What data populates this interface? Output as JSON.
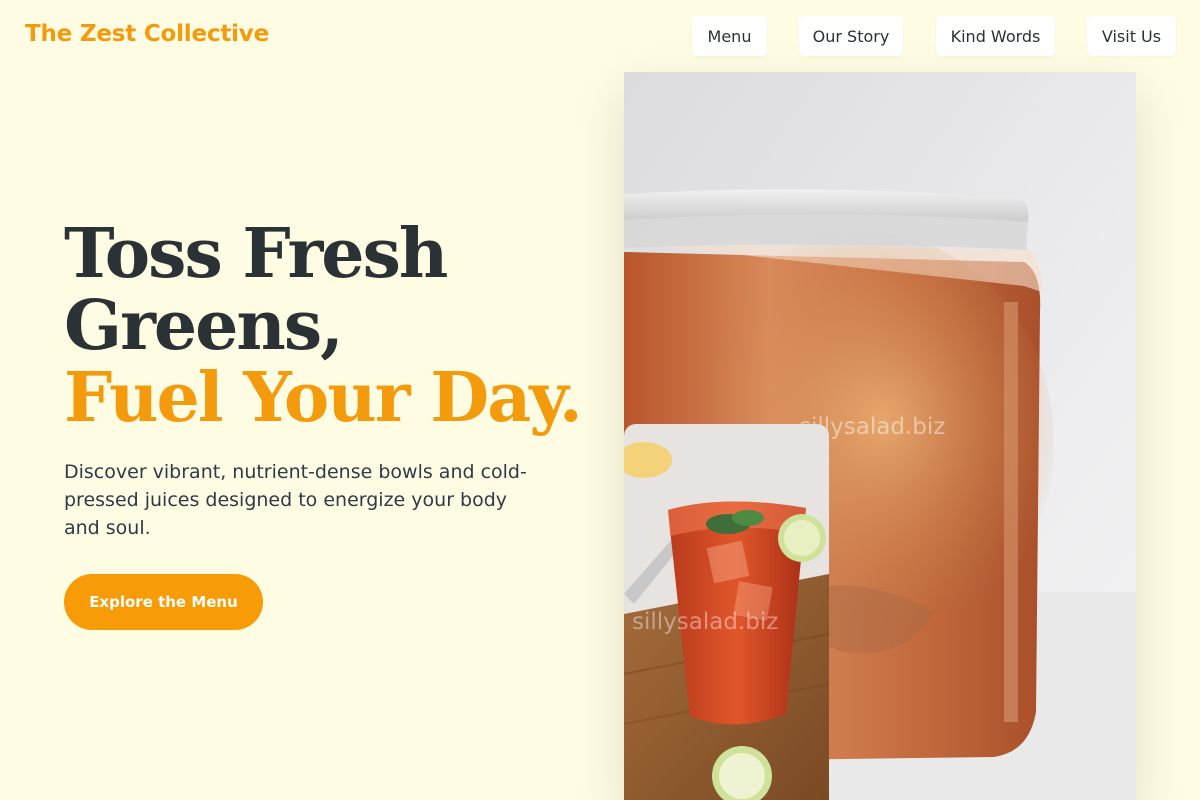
{
  "brand": {
    "name": "The Zest Collective"
  },
  "nav": {
    "items": [
      {
        "label": "Menu"
      },
      {
        "label": "Our Story"
      },
      {
        "label": "Kind Words"
      },
      {
        "label": "Visit Us"
      }
    ]
  },
  "hero": {
    "headline_line1": "Toss Fresh",
    "headline_line2": "Greens,",
    "headline_accent": "Fuel Your Day.",
    "subtitle": "Discover vibrant, nutrient-dense bowls and cold-pressed juices designed to energize your body and soul.",
    "cta_label": "Explore the Menu"
  },
  "images": {
    "main_watermark": "sillysalad.biz",
    "inset_watermark": "sillysalad.biz"
  },
  "colors": {
    "background": "#fefde4",
    "accent": "#f39a0d",
    "button": "#f79b07",
    "text_dark": "#2a3236"
  }
}
